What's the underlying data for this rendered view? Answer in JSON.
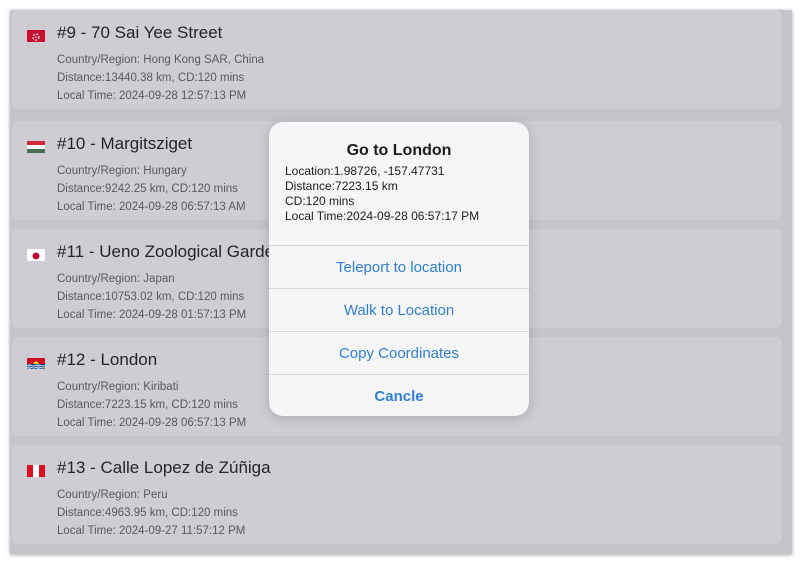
{
  "locations": [
    {
      "title": "#9 - 70 Sai Yee Street",
      "country": "Country/Region: Hong Kong SAR, China",
      "distance": "Distance:13440.38 km, CD:120 mins",
      "time": "Local Time: 2024-09-28 12:57:13 PM"
    },
    {
      "title": "#10 - Margitsziget",
      "country": "Country/Region: Hungary",
      "distance": "Distance:9242.25 km, CD:120 mins",
      "time": "Local Time: 2024-09-28 06:57:13 AM"
    },
    {
      "title": "#11 - Ueno Zoological Garden",
      "country": "Country/Region: Japan",
      "distance": "Distance:10753.02 km, CD:120 mins",
      "time": "Local Time: 2024-09-28 01:57:13 PM"
    },
    {
      "title": "#12 - London",
      "country": "Country/Region: Kiribati",
      "distance": "Distance:7223.15 km, CD:120 mins",
      "time": "Local Time: 2024-09-28 06:57:13 PM"
    },
    {
      "title": "#13 - Calle Lopez de Zúñiga",
      "country": "Country/Region: Peru",
      "distance": "Distance:4963.95 km, CD:120 mins",
      "time": "Local Time: 2024-09-27 11:57:12 PM"
    }
  ],
  "dialog": {
    "title": "Go to London",
    "location": "Location:1.98726, -157.47731",
    "distance": "Distance:7223.15 km",
    "cd": "CD:120 mins",
    "local_time": "Local Time:2024-09-28 06:57:17 PM",
    "teleport_label": "Teleport to location",
    "walk_label": "Walk to Location",
    "copy_label": "Copy Coordinates",
    "cancel_label": "Cancle"
  },
  "colors": {
    "accent": "#2f7fd3",
    "backdrop": "#c6c3ca",
    "card": "#cfccd3"
  }
}
